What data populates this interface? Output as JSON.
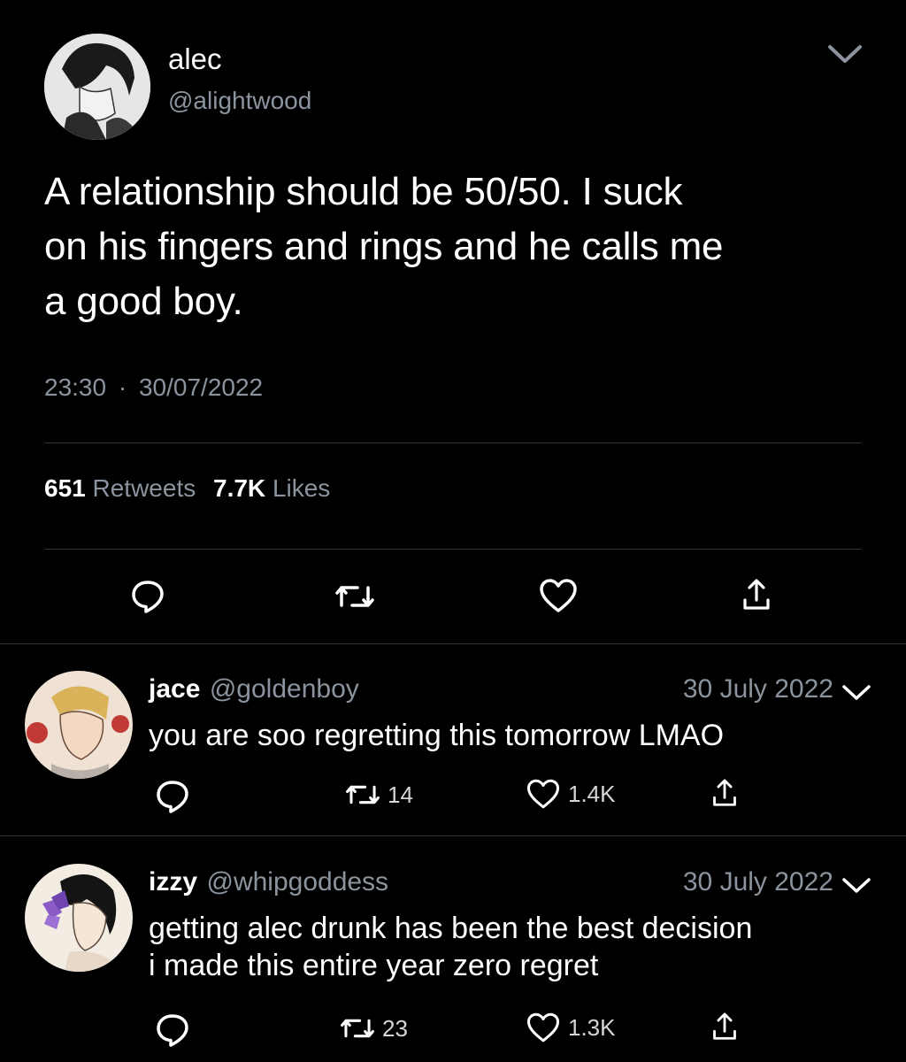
{
  "main_tweet": {
    "author_name": "alec",
    "author_handle": "@alightwood",
    "text_lines": [
      "A relationship should be 50/50. I suck",
      "on his fingers and rings and he calls me",
      "a good boy."
    ],
    "time": "23:30",
    "separator": "·",
    "date": "30/07/2022",
    "retweets_count": "651",
    "retweets_label": "Retweets",
    "likes_count": "7.7K",
    "likes_label": "Likes",
    "actions": [
      "reply-icon",
      "retweet-icon",
      "like-icon",
      "share-icon"
    ]
  },
  "replies": [
    {
      "author_name": "jace",
      "author_handle": "@goldenboy",
      "date": "30 July 2022",
      "text_lines": [
        "you are soo regretting this tomorrow LMAO"
      ],
      "retweets": "14",
      "likes": "1.4K"
    },
    {
      "author_name": "izzy",
      "author_handle": "@whipgoddess",
      "date": "30 July 2022",
      "text_lines": [
        "getting alec drunk has been the best decision",
        "i made this entire year zero regret"
      ],
      "retweets": "23",
      "likes": "1.3K"
    }
  ],
  "colors": {
    "background": "#000000",
    "text": "#ffffff",
    "secondary_text": "#8b949e",
    "divider": "#2f3336"
  }
}
